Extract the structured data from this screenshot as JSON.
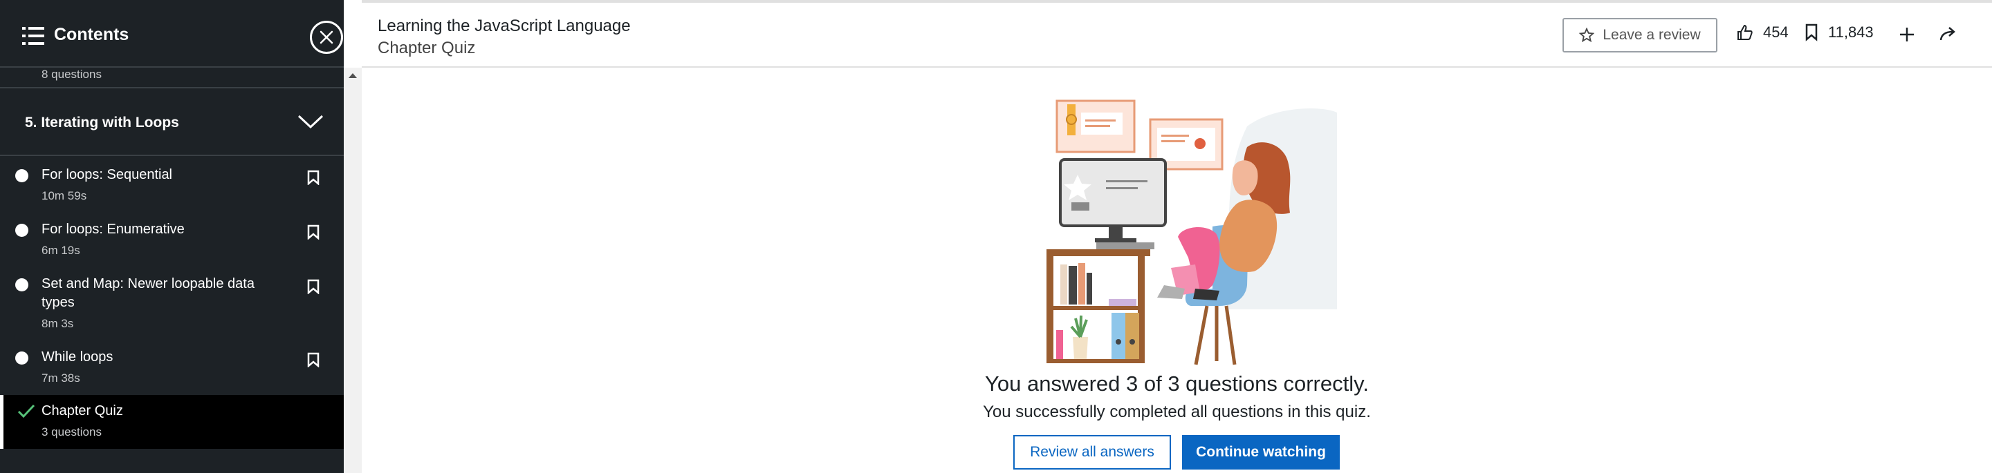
{
  "sidebar": {
    "title": "Contents",
    "previous_section_subtitle": "8 questions",
    "section": {
      "title": "5. Iterating with Loops"
    },
    "items": [
      {
        "title": "For loops: Sequential",
        "duration": "10m 59s"
      },
      {
        "title": "For loops: Enumerative",
        "duration": "6m 19s"
      },
      {
        "title": "Set and Map: Newer loopable data types",
        "duration": "8m 3s"
      },
      {
        "title": "While loops",
        "duration": "7m 38s"
      },
      {
        "title": "Chapter Quiz",
        "duration": "3 questions"
      }
    ]
  },
  "header": {
    "course_title": "Learning the JavaScript Language",
    "current_item": "Chapter Quiz",
    "review_label": "Leave a review",
    "likes": "454",
    "saves": "11,843"
  },
  "quiz_result": {
    "headline": "You answered 3 of 3 questions correctly.",
    "message": "You successfully completed all questions in this quiz.",
    "review_button": "Review all answers",
    "continue_button": "Continue watching"
  },
  "colors": {
    "sidebar_bg": "#1d2226",
    "accent": "#0a66c2"
  }
}
